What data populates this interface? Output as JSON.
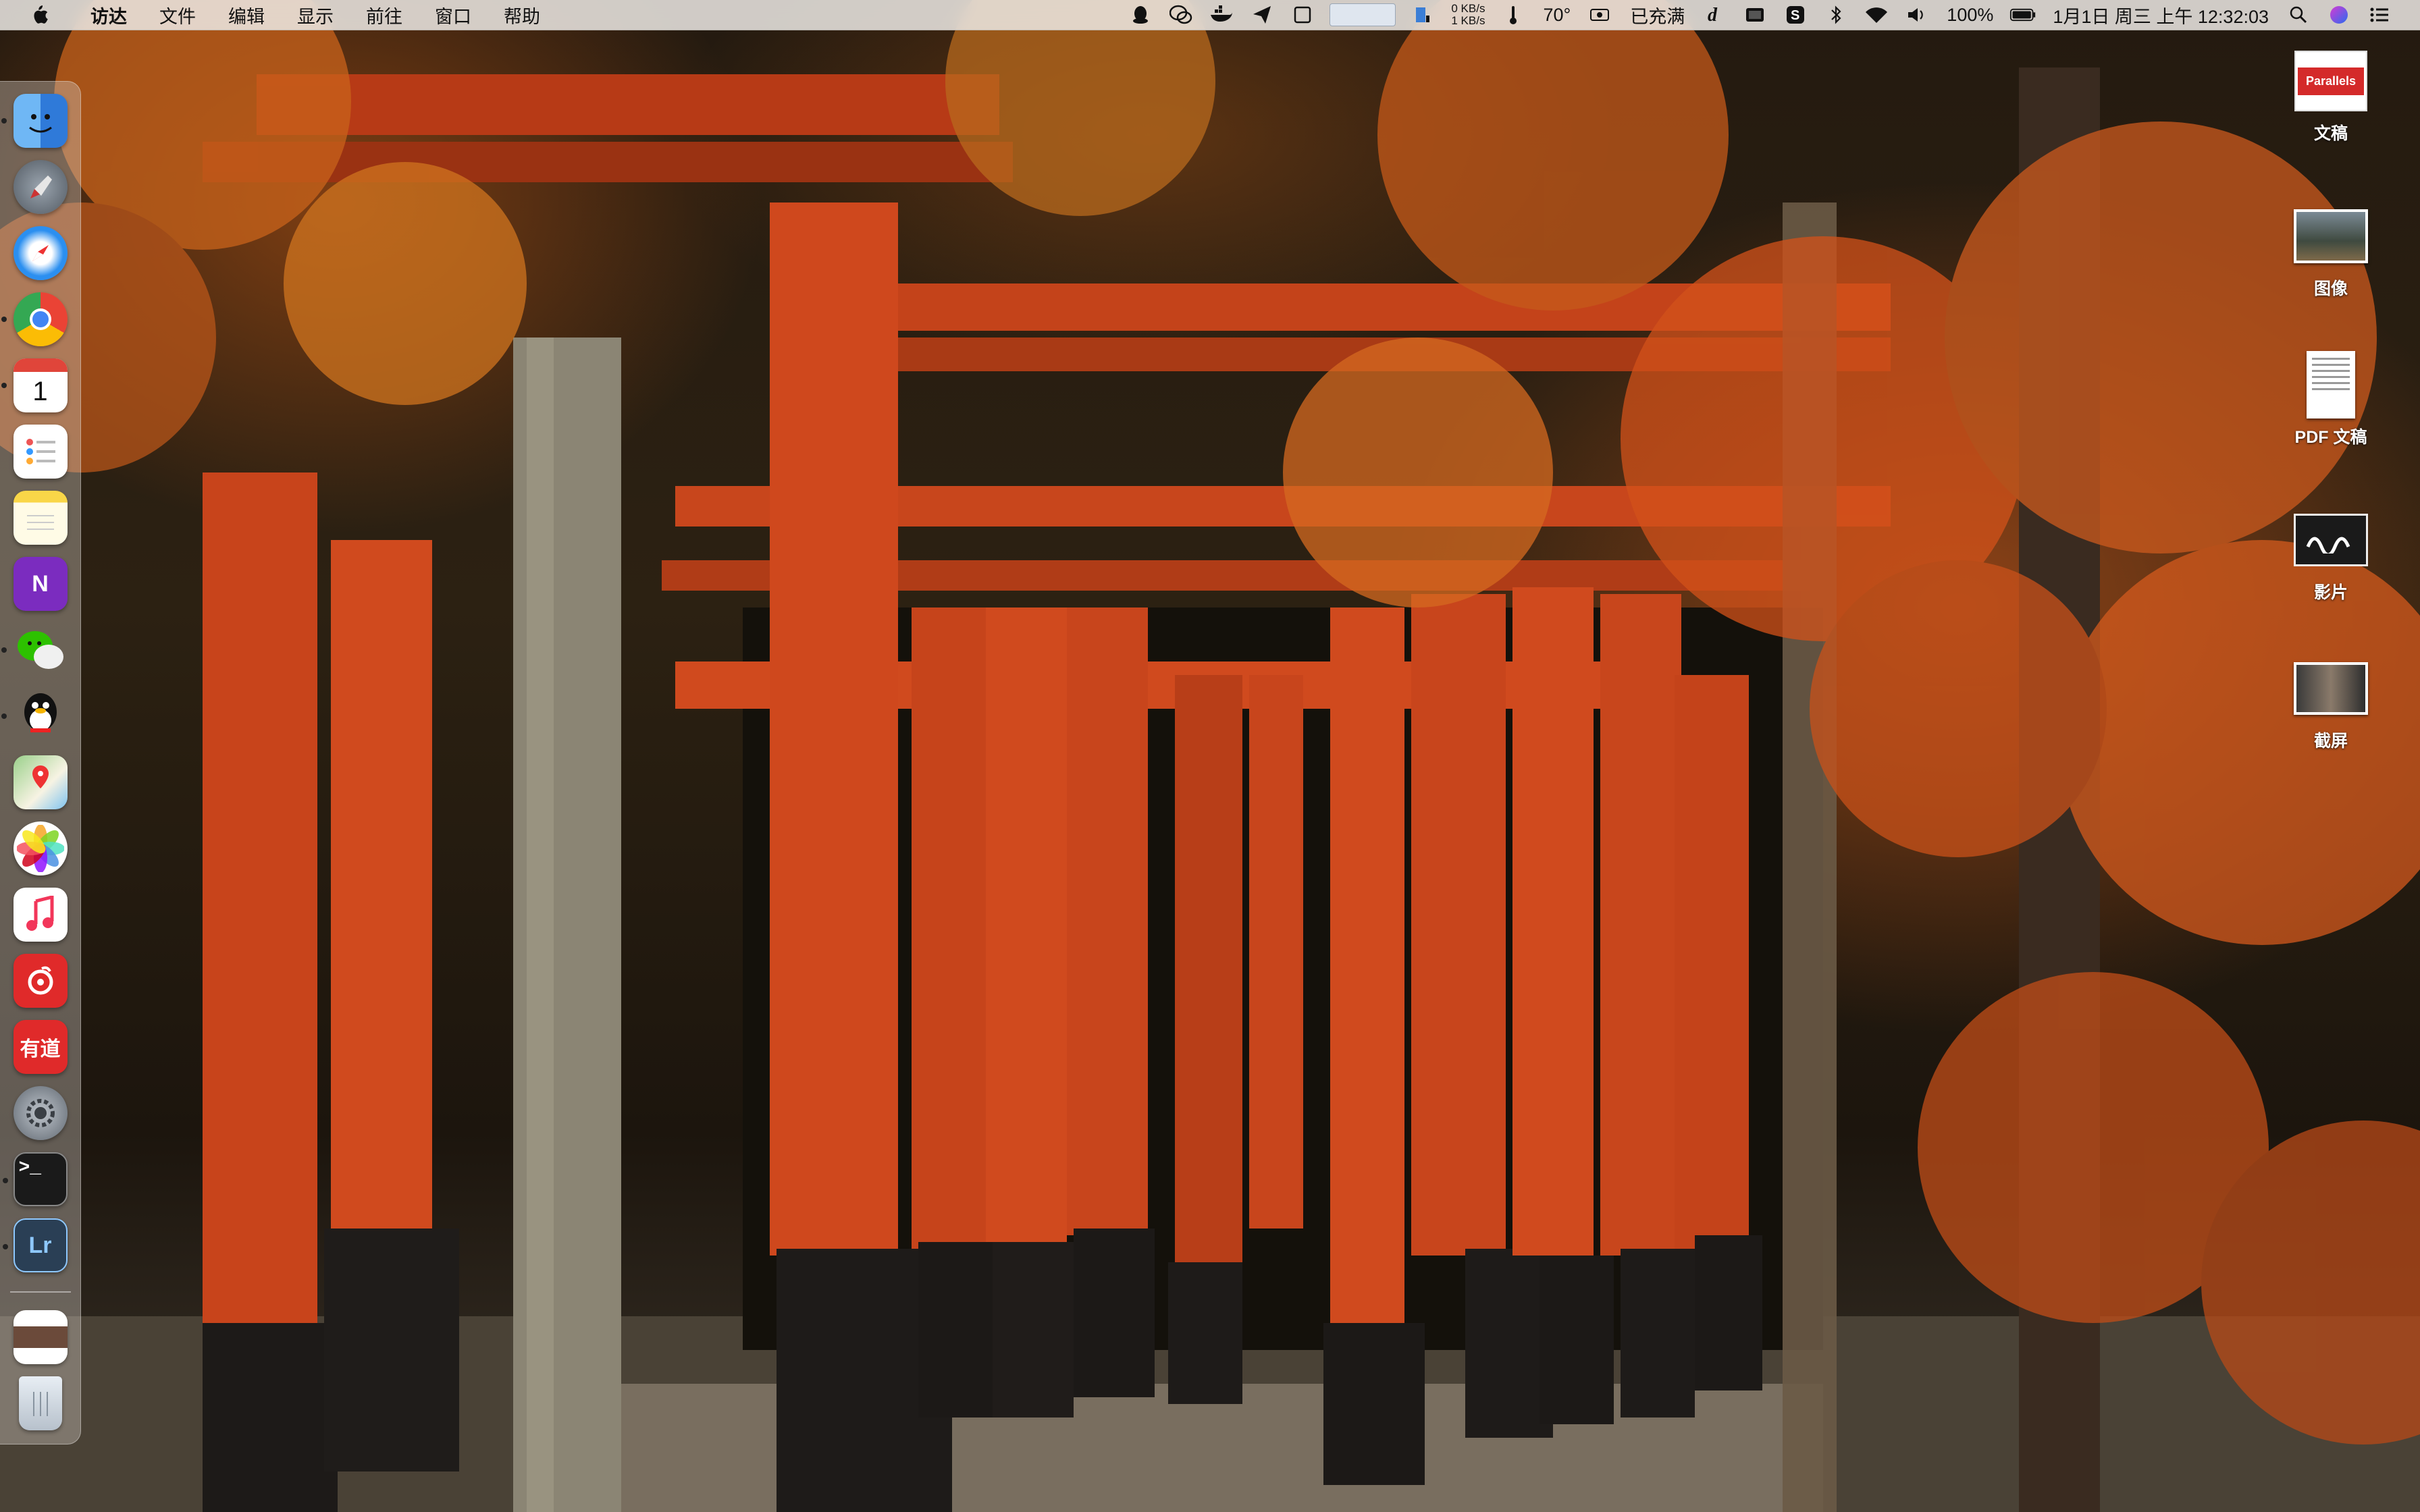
{
  "menubar": {
    "app_name": "访达",
    "menus": [
      "文件",
      "编辑",
      "显示",
      "前往",
      "窗口",
      "帮助"
    ],
    "net_up": "0 KB/s",
    "net_down": "1 KB/s",
    "temperature": "70°",
    "battery_status": "已充满",
    "battery_percent": "100%",
    "datetime": "1月1日 周三 上午 12:32:03"
  },
  "dock": {
    "apps": [
      {
        "name": "finder-app",
        "label": ""
      },
      {
        "name": "launchpad-app",
        "label": ""
      },
      {
        "name": "safari-app",
        "label": ""
      },
      {
        "name": "chrome-app",
        "label": ""
      },
      {
        "name": "calendar-app",
        "label": "1"
      },
      {
        "name": "reminders-app",
        "label": ""
      },
      {
        "name": "notes-app",
        "label": ""
      },
      {
        "name": "onenote-app",
        "label": "N"
      },
      {
        "name": "wechat-app",
        "label": ""
      },
      {
        "name": "qq-app",
        "label": ""
      },
      {
        "name": "maps-app",
        "label": ""
      },
      {
        "name": "photos-app",
        "label": ""
      },
      {
        "name": "music-app",
        "label": ""
      },
      {
        "name": "netease-music-app",
        "label": ""
      },
      {
        "name": "youdao-app",
        "label": "有道"
      },
      {
        "name": "system-preferences-app",
        "label": ""
      },
      {
        "name": "terminal-app",
        "label": ">_"
      },
      {
        "name": "lightroom-app",
        "label": "Lr"
      }
    ]
  },
  "desktop_icons": [
    {
      "name": "parallels-documents",
      "label": "文稿",
      "thumb": "Parallels"
    },
    {
      "name": "images-folder",
      "label": "图像",
      "thumb": ""
    },
    {
      "name": "pdf-documents",
      "label": "PDF 文稿",
      "thumb": ""
    },
    {
      "name": "movies-folder",
      "label": "影片",
      "thumb": ""
    },
    {
      "name": "screenshots-folder",
      "label": "截屏",
      "thumb": ""
    }
  ],
  "colors": {
    "torii_red": "#d2461e",
    "torii_dark": "#1e1a18",
    "menubar_bg": "#ece9e4"
  }
}
